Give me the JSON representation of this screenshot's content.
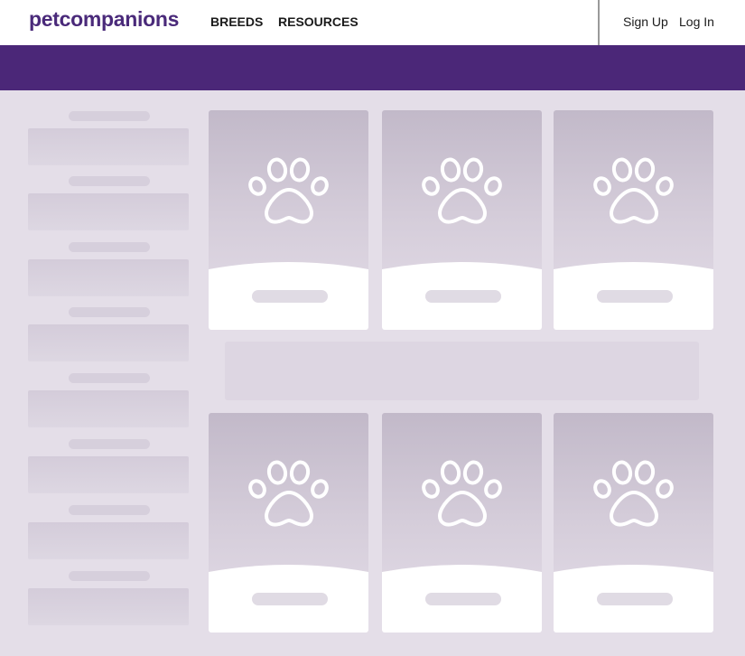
{
  "header": {
    "logo_text": "petcompanions",
    "nav": [
      {
        "label": "BREEDS"
      },
      {
        "label": "RESOURCES"
      }
    ],
    "auth": {
      "signup_label": "Sign Up",
      "login_label": "Log In"
    }
  },
  "colors": {
    "brand_purple": "#4b2778",
    "logo_purple": "#4a2a7a",
    "page_background": "#e4dee8",
    "skeleton": "#d6cfdc"
  },
  "sidebar": {
    "placeholder_items": 8
  },
  "grid": {
    "cards": [
      {
        "icon": "paw-icon"
      },
      {
        "icon": "paw-icon"
      },
      {
        "icon": "paw-icon"
      },
      {
        "icon": "paw-icon"
      },
      {
        "icon": "paw-icon"
      },
      {
        "icon": "paw-icon"
      }
    ]
  }
}
